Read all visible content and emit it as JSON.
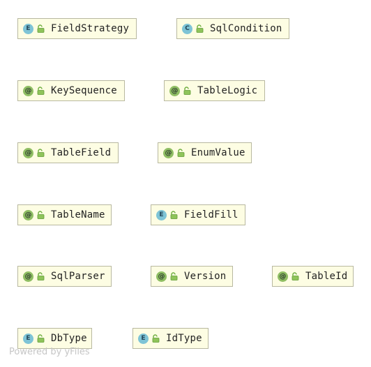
{
  "nodes": [
    {
      "id": "fieldstrategy",
      "kind": "enum",
      "badge": "E",
      "label": "FieldStrategy"
    },
    {
      "id": "sqlcondition",
      "kind": "class",
      "badge": "C",
      "label": "SqlCondition"
    },
    {
      "id": "keysequence",
      "kind": "annotation",
      "badge": "@",
      "label": "KeySequence"
    },
    {
      "id": "tablelogic",
      "kind": "annotation",
      "badge": "@",
      "label": "TableLogic"
    },
    {
      "id": "tablefield",
      "kind": "annotation",
      "badge": "@",
      "label": "TableField"
    },
    {
      "id": "enumvalue",
      "kind": "annotation",
      "badge": "@",
      "label": "EnumValue"
    },
    {
      "id": "tablename",
      "kind": "annotation",
      "badge": "@",
      "label": "TableName"
    },
    {
      "id": "fieldfill",
      "kind": "enum",
      "badge": "E",
      "label": "FieldFill"
    },
    {
      "id": "sqlparser",
      "kind": "annotation",
      "badge": "@",
      "label": "SqlParser"
    },
    {
      "id": "version",
      "kind": "annotation",
      "badge": "@",
      "label": "Version"
    },
    {
      "id": "tableid",
      "kind": "annotation",
      "badge": "@",
      "label": "TableId"
    },
    {
      "id": "dbtype",
      "kind": "enum",
      "badge": "E",
      "label": "DbType"
    },
    {
      "id": "idtype",
      "kind": "enum",
      "badge": "E",
      "label": "IdType"
    }
  ],
  "icons": {
    "visibility": "open-lock-icon",
    "lock_color": "#6fae3f"
  },
  "watermark": "Powered by yFiles"
}
